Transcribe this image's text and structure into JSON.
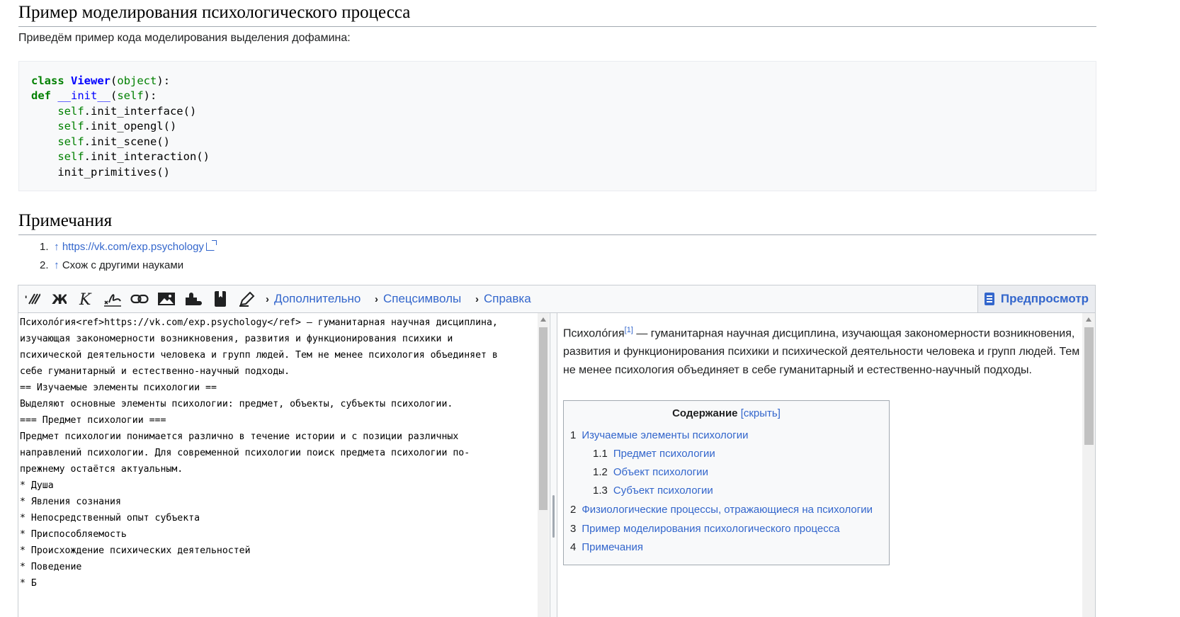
{
  "section_model": {
    "heading": "Пример моделирования психологического процесса",
    "intro": "Приведём пример кода моделирования выделения дофамина:"
  },
  "code": {
    "line1": {
      "kw": "class",
      "cls": "Viewer",
      "p1": "(",
      "base": "object",
      "p2": "):"
    },
    "line2": {
      "kw": "def",
      "fn": "__init__",
      "p1": "(",
      "self": "self",
      "p2": "):"
    },
    "line3": {
      "self": "self",
      "rest": ".init_interface()"
    },
    "line4": {
      "self": "self",
      "rest": ".init_opengl()"
    },
    "line5": {
      "self": "self",
      "rest": ".init_scene()"
    },
    "line6": {
      "self": "self",
      "rest": ".init_interaction()"
    },
    "line7": {
      "rest": "init_primitives()"
    }
  },
  "section_notes": {
    "heading": "Примечания",
    "refs": [
      {
        "num": "1.",
        "arrow": "↑",
        "text": "https://vk.com/exp.psychology"
      },
      {
        "num": "2.",
        "arrow": "↑",
        "text": "Схож с другими науками"
      }
    ]
  },
  "toolbar": {
    "groups": [
      "Дополнительно",
      "Спецсимволы",
      "Справка"
    ],
    "preview_label": "Предпросмотр"
  },
  "source_lines": [
    "Психоло́гия<ref>https://vk.com/exp.psychology</ref> — гуманитарная научная дисциплина,",
    "изучающая закономерности возникновения, развития и функционирования психики и",
    "психической деятельности человека и групп людей. Тем не менее психология объединяет в",
    "себе гуманитарный и естественно-научный подходы.",
    "== Изучаемые элементы психологии ==",
    "Выделяют основные элементы психологии: предмет, объекты, субъекты психологии.",
    "=== Предмет психологии ===",
    "Предмет психологии понимается различно в течение истории и с позиции различных",
    "направлений психологии. Для современной психологии поиск предмета психологии по-",
    "прежнему остаётся актуальным.",
    "* Душа",
    "* Явления сознания",
    "* Непосредственный опыт субъекта",
    "* Приспособляемость",
    "* Происхождение психических деятельностей",
    "* Поведение",
    "* Б"
  ],
  "preview": {
    "word": "Психоло́гия",
    "sup": "[1]",
    "text": " — гуманитарная научная дисциплина, изучающая закономерности возникновения, развития и функционирования психики и психической деятельности человека и групп людей. Тем не менее психология объединяет в себе гуманитарный и естественно-научный подходы."
  },
  "toc": {
    "title": "Содержание",
    "hide": "[скрыть]",
    "items": [
      {
        "num": "1",
        "label": "Изучаемые элементы психологии"
      },
      {
        "num": "1.1",
        "label": "Предмет психологии"
      },
      {
        "num": "1.2",
        "label": "Объект психологии"
      },
      {
        "num": "1.3",
        "label": "Субъект психологии"
      },
      {
        "num": "2",
        "label": "Физиологические процессы, отражающиеся на психологии"
      },
      {
        "num": "3",
        "label": "Пример моделирования психологического процесса"
      },
      {
        "num": "4",
        "label": "Примечания"
      }
    ]
  },
  "icons": [
    "format-icon",
    "bold-icon",
    "italic-icon",
    "signature-icon",
    "link-icon",
    "image-icon",
    "puzzle-icon",
    "bookmark-icon",
    "pen-icon",
    "chevron-right-icon",
    "document-icon"
  ],
  "colors": {
    "link": "#3366cc",
    "code_keyword": "#008000",
    "code_name": "#0000ff",
    "border": "#a2a9b1"
  }
}
